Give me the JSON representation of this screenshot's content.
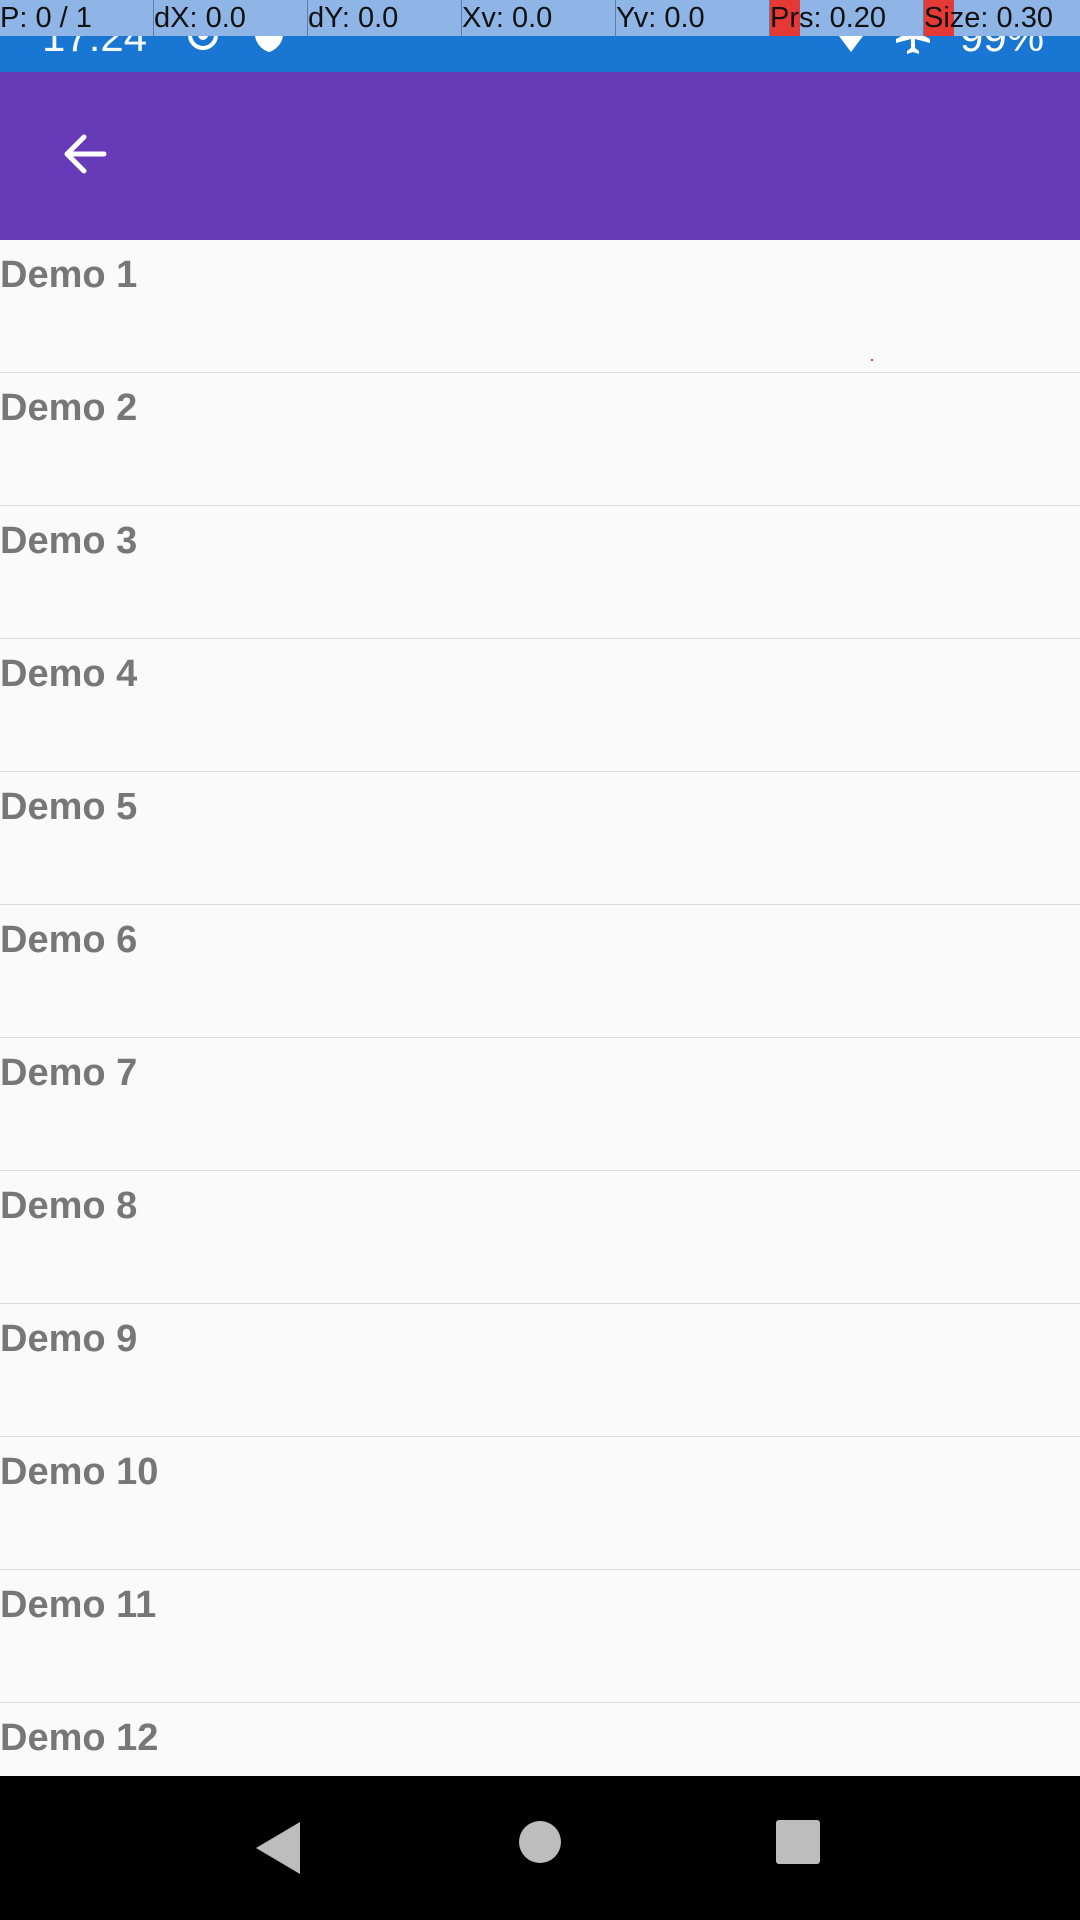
{
  "status_bar": {
    "time": "17:24",
    "battery": "99%",
    "icons": [
      "target-icon",
      "shield-icon",
      "wifi-icon",
      "airplane-icon"
    ]
  },
  "pointer_overlay": {
    "cells": [
      {
        "label": "P: 0 / 1",
        "highlight": false
      },
      {
        "label": "dX: 0.0",
        "highlight": false
      },
      {
        "label": "dY: 0.0",
        "highlight": false
      },
      {
        "label": "Xv: 0.0",
        "highlight": false
      },
      {
        "label": "Yv: 0.0",
        "highlight": false
      },
      {
        "label": "Prs: 0.20",
        "highlight": true
      },
      {
        "label": "Size: 0.30",
        "highlight": true
      }
    ]
  },
  "app_bar": {
    "back_icon": "arrow-left-icon"
  },
  "list": {
    "items": [
      {
        "label": "Demo 1"
      },
      {
        "label": "Demo 2"
      },
      {
        "label": "Demo 3"
      },
      {
        "label": "Demo 4"
      },
      {
        "label": "Demo 5"
      },
      {
        "label": "Demo 6"
      },
      {
        "label": "Demo 7"
      },
      {
        "label": "Demo 8"
      },
      {
        "label": "Demo 9"
      },
      {
        "label": "Demo 10"
      },
      {
        "label": "Demo 11"
      },
      {
        "label": "Demo 12"
      }
    ]
  },
  "nav_bar": {
    "buttons": [
      "back-triangle-icon",
      "home-circle-icon",
      "recents-square-icon"
    ]
  },
  "colors": {
    "status_bar": "#1976d2",
    "app_bar": "#673ab7",
    "overlay": "#8fb4e6",
    "overlay_highlight": "#e53935",
    "list_text": "#777777",
    "background": "#fafafa"
  }
}
